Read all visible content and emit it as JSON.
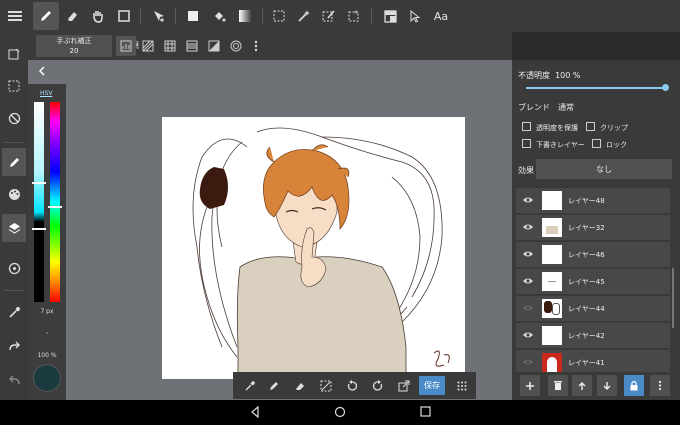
{
  "toolbar": {
    "icons": [
      "menu-icon",
      "pen-icon",
      "eraser-icon",
      "hand-icon",
      "rect-icon",
      "move-icon",
      "fill-rect-icon",
      "bucket-icon",
      "gradient-icon",
      "select-rect-icon",
      "magic-wand-icon",
      "select-pen-icon",
      "transform-select-icon",
      "layout-icon",
      "pointer-icon",
      "text-icon"
    ],
    "text_tool_label": "Aa"
  },
  "stabilizer": {
    "label": "手ぶれ補正",
    "value": "20"
  },
  "ruler": {
    "label": "定規"
  },
  "color": {
    "mode_label": "HSV",
    "brush_size": "7 px",
    "opacity": "100 %",
    "current": "#1c3b41"
  },
  "bottom": {
    "save_label": "保存"
  },
  "layer_props": {
    "opacity_label": "不透明度",
    "opacity_value": "100 %",
    "blend_label": "ブレンド",
    "blend_value": "通常",
    "protect_alpha": "透明度を保護",
    "clip": "クリップ",
    "draft": "下書きレイヤー",
    "lock": "ロック",
    "effect_label": "効果",
    "effect_value": "なし"
  },
  "layers": [
    {
      "name": "レイヤー48",
      "visible": true
    },
    {
      "name": "レイヤー32",
      "visible": true
    },
    {
      "name": "レイヤー46",
      "visible": true
    },
    {
      "name": "レイヤー45",
      "visible": true
    },
    {
      "name": "レイヤー44",
      "visible": false
    },
    {
      "name": "レイヤー42",
      "visible": true
    },
    {
      "name": "レイヤー41",
      "visible": false
    }
  ],
  "colors": {
    "accent": "#4a8bc7",
    "panel": "#3a3a3a",
    "workspace": "#6e7176"
  }
}
